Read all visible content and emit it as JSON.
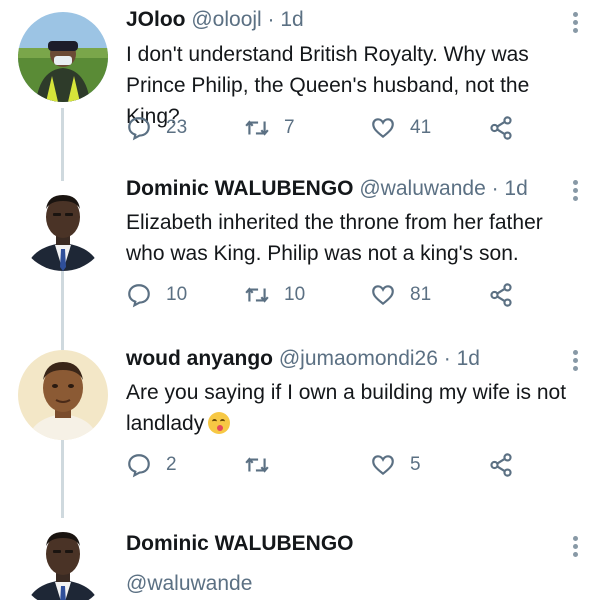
{
  "tweets": [
    {
      "name": "JOloo",
      "handle": "@oloojl",
      "time": " · 1d",
      "text": "I don't understand British Royalty. Why was Prince Philip, the Queen's husband, not the King?",
      "replies": "23",
      "retweets": "7",
      "likes": "41",
      "avatar": "person-in-field"
    },
    {
      "name": "Dominic WALUBENGO",
      "handle": "@waluwande",
      "time": " · 1d",
      "text": "Elizabeth inherited the throne from her father who was King. Philip was not a king's son.",
      "replies": "10",
      "retweets": "10",
      "likes": "81",
      "avatar": "man-in-suit"
    },
    {
      "name": "woud anyango",
      "handle": "@jumaomondi26",
      "time": " · 1d",
      "text": "Are you saying if I own a building my wife is not landlady",
      "emoji": "face-savoring-food",
      "replies": "2",
      "retweets": "",
      "likes": "5",
      "avatar": "man-portrait"
    },
    {
      "name": "Dominic WALUBENGO",
      "handle": "@waluwande",
      "avatar": "man-in-suit"
    }
  ],
  "icons": {
    "reply": "reply-icon",
    "retweet": "retweet-icon",
    "like": "heart-icon",
    "share": "share-icon",
    "more": "more-icon"
  },
  "colors": {
    "text": "#14171a",
    "secondary": "#5b7083",
    "thread_line": "#cfd9de"
  }
}
